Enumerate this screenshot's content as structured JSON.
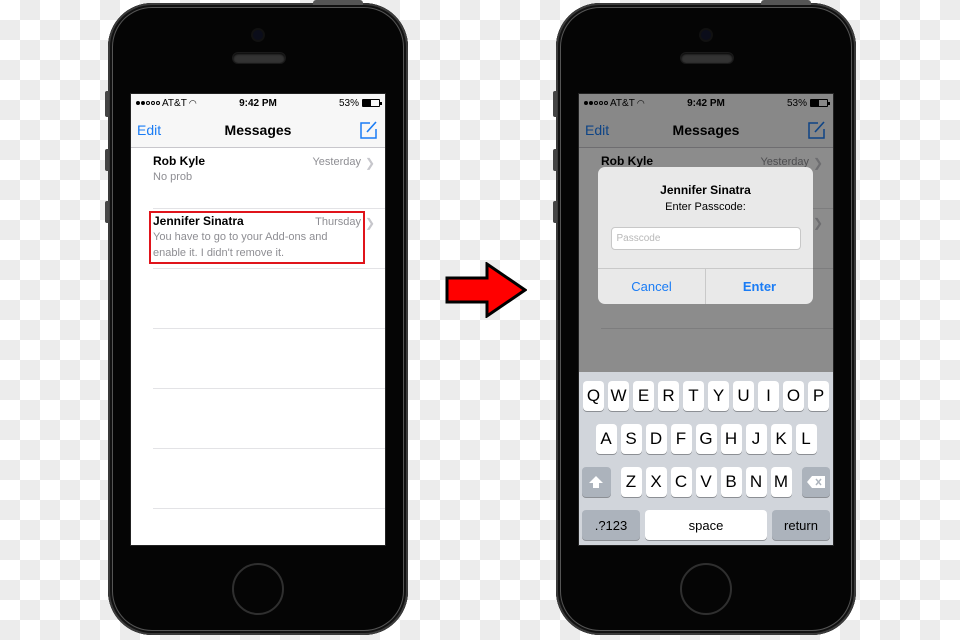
{
  "status_bar": {
    "carrier": "AT&T",
    "time": "9:42 PM",
    "battery": "53%",
    "battery_level": 0.53,
    "signal_bars": 2,
    "signal_total": 5
  },
  "nav": {
    "edit_label": "Edit",
    "title": "Messages",
    "compose_icon": "compose-icon"
  },
  "messages": [
    {
      "name": "Rob Kyle",
      "time": "Yesterday",
      "preview": "No prob"
    },
    {
      "name": "Jennifer Sinatra",
      "time": "Thursday",
      "preview": "You have to go to your Add-ons and enable it. I didn't remove it."
    }
  ],
  "highlight_color": "#e0141b",
  "arrow": {
    "icon": "right-arrow-icon",
    "color": "#ff0000"
  },
  "alert": {
    "title": "Jennifer Sinatra",
    "message": "Enter Passcode:",
    "input_placeholder": "Passcode",
    "input_value": "",
    "cancel_label": "Cancel",
    "enter_label": "Enter"
  },
  "keyboard": {
    "row1": [
      "Q",
      "W",
      "E",
      "R",
      "T",
      "Y",
      "U",
      "I",
      "O",
      "P"
    ],
    "row2": [
      "A",
      "S",
      "D",
      "F",
      "G",
      "H",
      "J",
      "K",
      "L"
    ],
    "row3": [
      "Z",
      "X",
      "C",
      "V",
      "B",
      "N",
      "M"
    ],
    "shift_icon": "shift-icon",
    "delete_icon": "delete-icon",
    "numbers_label": ".?123",
    "space_label": "space",
    "return_label": "return"
  },
  "accent_color": "#1a7cf5"
}
